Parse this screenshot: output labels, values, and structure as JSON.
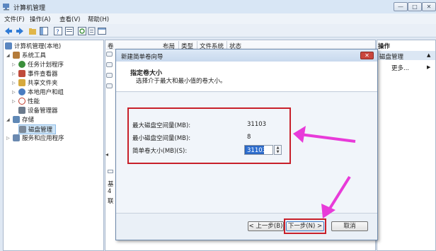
{
  "window": {
    "title": "计算机管理",
    "minimize": "—",
    "maximize": "□",
    "close": "✕"
  },
  "menu": [
    "文件(F)",
    "操作(A)",
    "查看(V)",
    "帮助(H)"
  ],
  "toolbar": {
    "icons": [
      "back-icon",
      "forward-icon",
      "up-folder-icon",
      "console-tree-icon",
      "help-icon",
      "properties-icon",
      "refresh-icon",
      "export-icon",
      "console-icon"
    ],
    "colors": {
      "back": "#2f7bd6",
      "forward": "#2f7bd6",
      "folder": "#e0b64a"
    }
  },
  "tree": [
    {
      "label": "计算机管理(本地)",
      "icon": "computer-icon",
      "color": "#5a86c0"
    },
    {
      "label": "系统工具",
      "icon": "tools-icon",
      "color": "#b57c3a"
    },
    {
      "label": "任务计划程序",
      "icon": "clock-icon",
      "color": "#3b8f3b"
    },
    {
      "label": "事件查看器",
      "icon": "event-viewer-icon",
      "color": "#c04b3b"
    },
    {
      "label": "共享文件夹",
      "icon": "shared-folder-icon",
      "color": "#d6a93e"
    },
    {
      "label": "本地用户和组",
      "icon": "users-icon",
      "color": "#4a7cc0"
    },
    {
      "label": "性能",
      "icon": "performance-icon",
      "color": "#c0392b"
    },
    {
      "label": "设备管理器",
      "icon": "device-manager-icon",
      "color": "#6b7a8c"
    },
    {
      "label": "存储",
      "icon": "storage-icon",
      "color": "#5f88b6"
    },
    {
      "label": "磁盘管理",
      "icon": "disk-icon",
      "color": "#7c8a9a"
    },
    {
      "label": "服务和应用程序",
      "icon": "services-icon",
      "color": "#6a89b0"
    }
  ],
  "center": {
    "columns": [
      "卷",
      "布局",
      "类型",
      "文件系统",
      "状态"
    ],
    "fragments": [
      "基",
      "4",
      "联"
    ]
  },
  "actions": {
    "title": "操作",
    "section": "磁盘管理",
    "more": "更多..."
  },
  "wizard": {
    "title": "新建简单卷向导",
    "close": "✕",
    "heading": "指定卷大小",
    "subheading": "选择介于最大和最小值的卷大小。",
    "fields": [
      {
        "label": "最大磁盘空间量(MB):",
        "value": "31103"
      },
      {
        "label": "最小磁盘空间量(MB):",
        "value": "8"
      }
    ],
    "size_label": "简单卷大小(MB)(S):",
    "size_value": "31103",
    "buttons": {
      "back": "< 上一步(B)",
      "next": "下一步(N) >",
      "cancel": "取消"
    },
    "highlight_color": "#c8202a",
    "arrow_color": "#e83bd9"
  }
}
